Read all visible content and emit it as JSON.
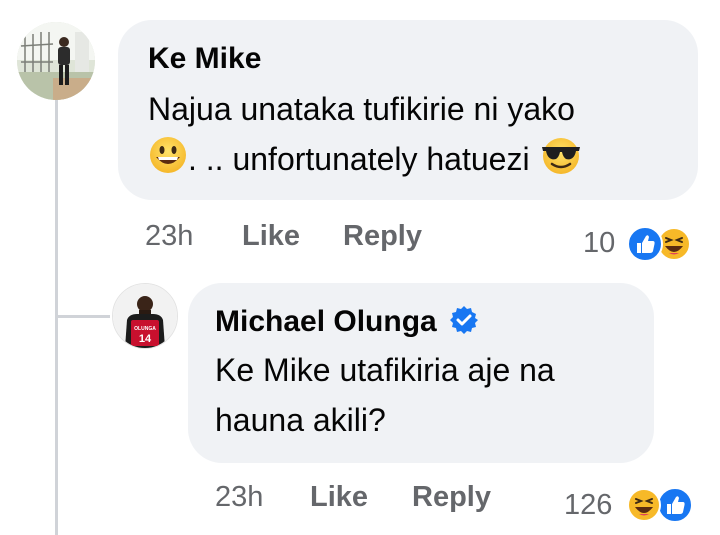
{
  "comments": [
    {
      "author": "Ke Mike",
      "line1": "Najua unataka tufikirie ni yako",
      "line2_after_emoji": ". .. unfortunately hatuezi",
      "time": "23h",
      "like_label": "Like",
      "reply_label": "Reply",
      "reaction_count": "10",
      "reactions": [
        "like-icon",
        "haha-icon"
      ],
      "inline_emojis": [
        "grinning-face-icon",
        "sunglasses-face-icon"
      ]
    },
    {
      "author": "Michael Olunga",
      "verified": true,
      "line1": "Ke Mike utafikiria aje na",
      "line2": "hauna akili?",
      "time": "23h",
      "like_label": "Like",
      "reply_label": "Reply",
      "reaction_count": "126",
      "reactions": [
        "haha-icon",
        "like-icon"
      ],
      "jersey_text": "OLUNGA",
      "jersey_number": "14"
    }
  ],
  "colors": {
    "bubble": "#f0f2f5",
    "meta_text": "#65676b",
    "like_blue": "#1877f2",
    "verified_blue": "#1877f2",
    "emoji_yellow": "#f7b928"
  }
}
